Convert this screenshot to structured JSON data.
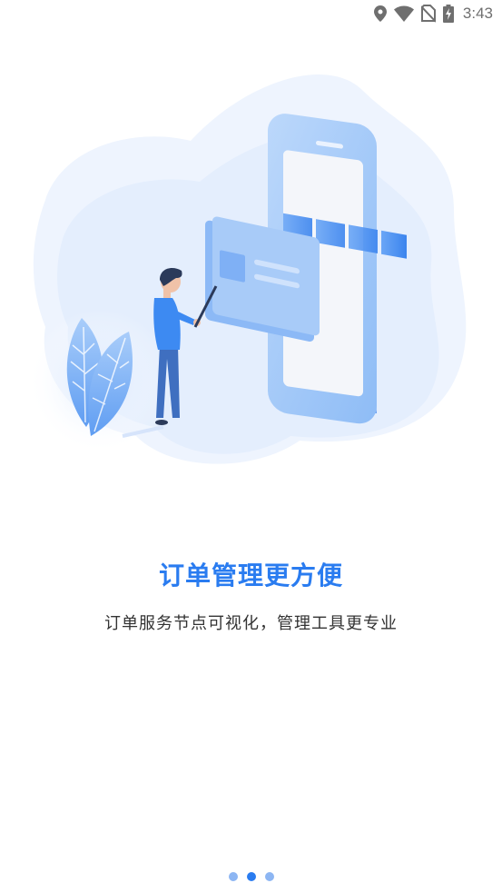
{
  "status_bar": {
    "time": "3:43",
    "icons": [
      "location-icon",
      "wifi-icon",
      "no-sim-icon",
      "battery-charging-icon"
    ]
  },
  "onboarding": {
    "title": "订单管理更方便",
    "subtitle": "订单服务节点可视化，管理工具更专业",
    "illustration": "person-pointing-at-phone-illustration"
  },
  "pager": {
    "count": 3,
    "active_index": 1
  },
  "colors": {
    "accent": "#2a7cf0",
    "dot_inactive": "#8db6f3",
    "text": "#333333"
  }
}
